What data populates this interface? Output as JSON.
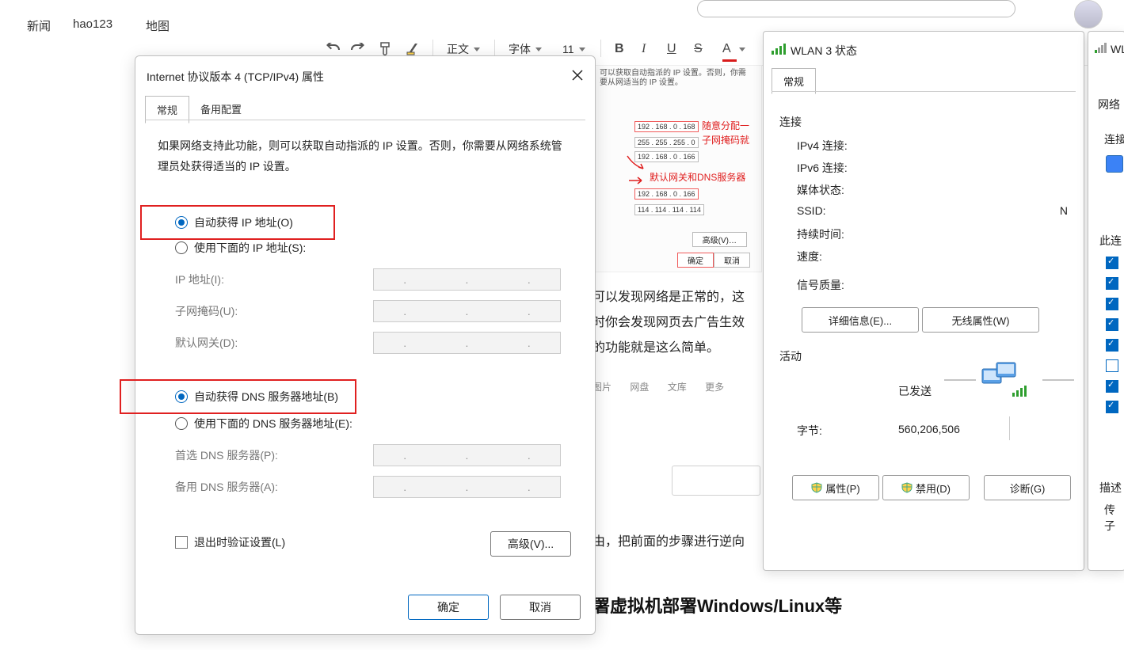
{
  "topnav": {
    "news": "新闻",
    "hao": "hao123",
    "map": "地图"
  },
  "toolbar": {
    "para": "正文",
    "font": "字体",
    "size": "11"
  },
  "imgnotes": {
    "ip1": "192 . 168 .  0  . 168",
    "mask": "255 . 255 . 255 .  0",
    "ip2": "192 . 168 .  0  . 166",
    "ip3": "192 . 168 .  0  . 166",
    "dns": "114 . 114 . 114 . 114",
    "r1": "随意分配一",
    "r2": "子网掩码就",
    "r3": "默认网关和DNS服务器",
    "adv": "高级(V)…",
    "ok": "确定",
    "cancel": "取消",
    "garble": "可以获取自动指派的 IP 设置。否则，你需要从网适当的 IP 设置。"
  },
  "body": {
    "l1": "可以发现网络是正常的，这",
    "l2": "时你会发现网页去广告生效",
    "l3": "的功能就是这么简单。",
    "l4": "由，把前面的步骤进行逆向",
    "h2": "署虚拟机部署Windows/Linux等"
  },
  "tags": {
    "t1": "图片",
    "t2": "网盘",
    "t3": "文库",
    "t4": "更多"
  },
  "dlg": {
    "title": "Internet 协议版本 4 (TCP/IPv4) 属性",
    "tab1": "常规",
    "tab2": "备用配置",
    "desc": "如果网络支持此功能，则可以获取自动指派的 IP 设置。否则，你需要从网络系统管理员处获得适当的 IP 设置。",
    "r_auto_ip": "自动获得 IP 地址(O)",
    "r_use_ip": "使用下面的 IP 地址(S):",
    "f_ip": "IP 地址(I):",
    "f_mask": "子网掩码(U):",
    "f_gw": "默认网关(D):",
    "r_auto_dns": "自动获得 DNS 服务器地址(B)",
    "r_use_dns": "使用下面的 DNS 服务器地址(E):",
    "f_dns1": "首选 DNS 服务器(P):",
    "f_dns2": "备用 DNS 服务器(A):",
    "chk": "退出时验证设置(L)",
    "adv": "高级(V)...",
    "ok": "确定",
    "cancel": "取消"
  },
  "wlan": {
    "title": "WLAN 3 状态",
    "tab": "常规",
    "sect1": "连接",
    "r1": "IPv4 连接:",
    "r2": "IPv6 连接:",
    "r3": "媒体状态:",
    "r4": "SSID:",
    "r5": "持续时间:",
    "r6": "速度:",
    "r7": "信号质量:",
    "b_detail": "详细信息(E)...",
    "b_wifi": "无线属性(W)",
    "sect2": "活动",
    "sent": "已发送",
    "bytes": "字节:",
    "bytes_v": "560,206,506",
    "b_prop": "属性(P)",
    "b_dis": "禁用(D)",
    "b_diag": "诊断(G)",
    "rn": "N"
  },
  "dlg3": {
    "title": "WL",
    "t1": "网络",
    "t2": "连接",
    "t3": "此连",
    "t4": "描述",
    "t5": "传",
    "t6": "子"
  }
}
